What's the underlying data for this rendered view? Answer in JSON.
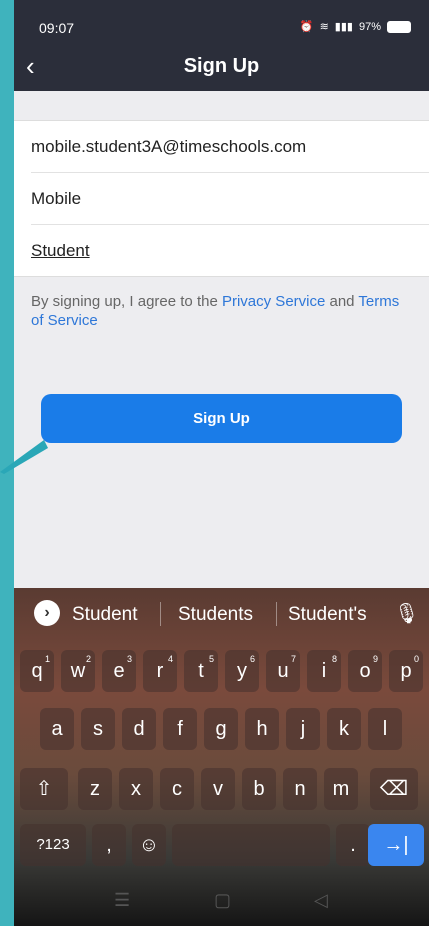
{
  "status_bar": {
    "time": "09:07",
    "battery": "97%"
  },
  "header": {
    "title": "Sign Up",
    "back_glyph": "‹"
  },
  "form": {
    "email": "mobile.student3A@timeschools.com",
    "first_name": "Mobile",
    "last_name": "Student"
  },
  "terms": {
    "prefix": "By signing up, I agree to the ",
    "privacy_link": "Privacy Service",
    "middle": " and ",
    "terms_link": "Terms of Service"
  },
  "signup_button": {
    "label": "Sign Up"
  },
  "keyboard": {
    "suggestions": [
      "Student",
      "Students",
      "Student's"
    ],
    "row1": [
      [
        "q",
        "1"
      ],
      [
        "w",
        "2"
      ],
      [
        "e",
        "3"
      ],
      [
        "r",
        "4"
      ],
      [
        "t",
        "5"
      ],
      [
        "y",
        "6"
      ],
      [
        "u",
        "7"
      ],
      [
        "i",
        "8"
      ],
      [
        "o",
        "9"
      ],
      [
        "p",
        "0"
      ]
    ],
    "row2": [
      "a",
      "s",
      "d",
      "f",
      "g",
      "h",
      "j",
      "k",
      "l"
    ],
    "row3": [
      "z",
      "x",
      "c",
      "v",
      "b",
      "n",
      "m"
    ],
    "symbols_label": "?123",
    "comma": ",",
    "period": ".",
    "shift_icon": "⇧",
    "backspace_icon": "⌫",
    "enter_icon": "→|"
  },
  "colors": {
    "accent": "#1a7ce8",
    "topbar": "#2b2e3a",
    "link": "#2e77d8"
  }
}
